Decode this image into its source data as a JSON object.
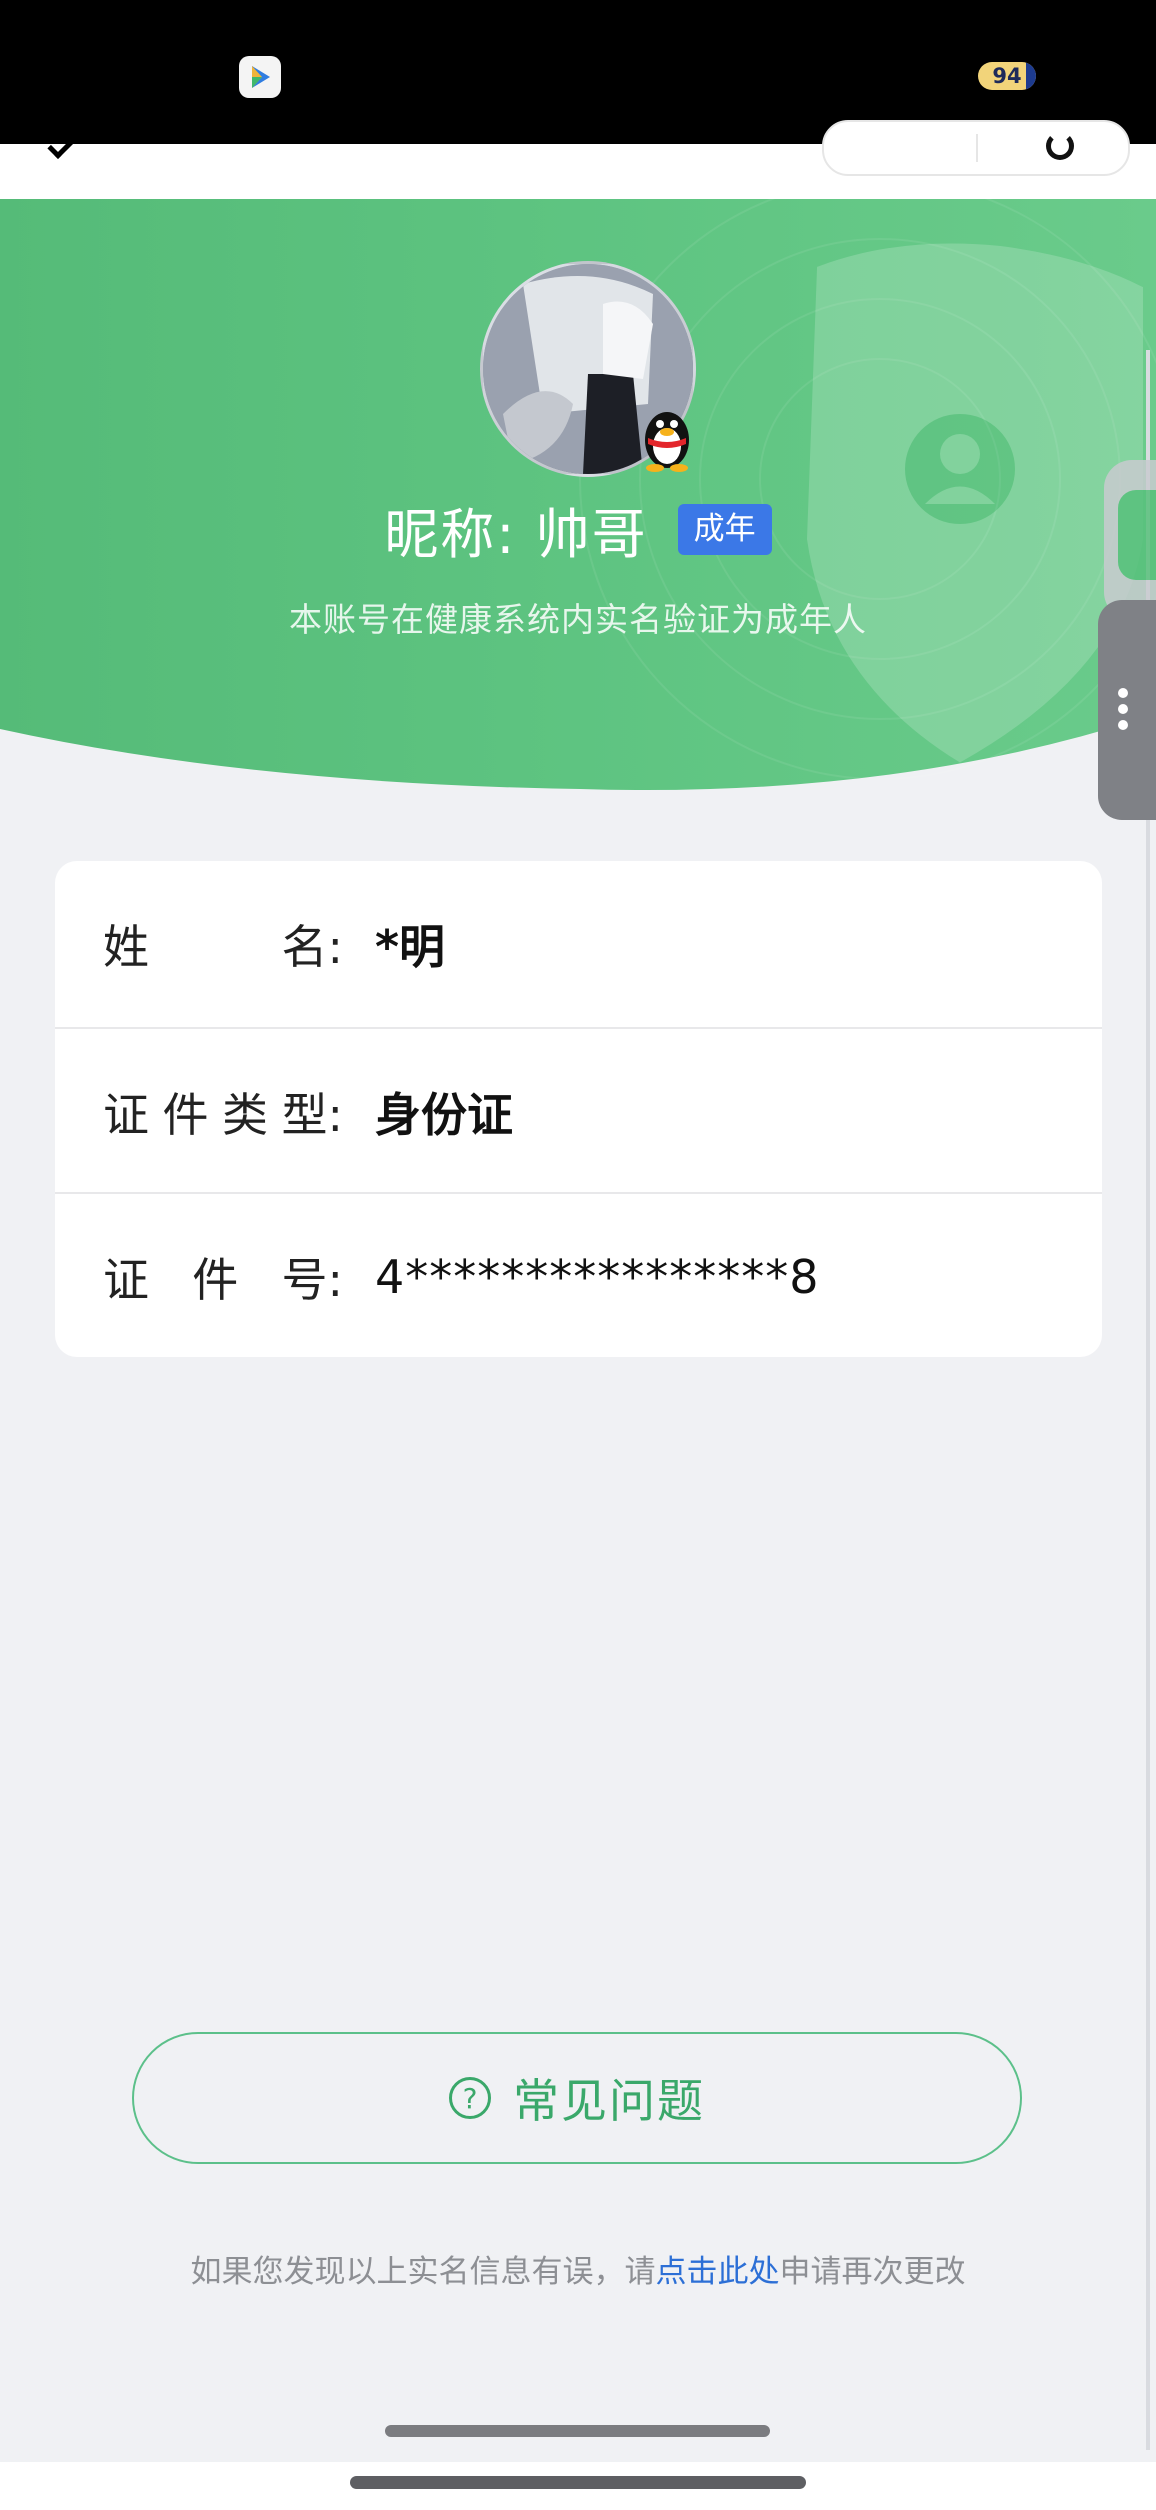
{
  "profile": {
    "nickname": "昵称:  帅哥",
    "adult_tag": "成年",
    "subtitle": "本账号在健康系统内实名验证为成年人"
  },
  "status_bar": {
    "battery_level": "94"
  },
  "info": {
    "name_label_chars": [
      "姓",
      "名:"
    ],
    "name_value": "*明",
    "id_type_label_chars": [
      "证",
      "件",
      "类",
      "型:"
    ],
    "id_type_value": "身份证",
    "id_number_label_chars": [
      "证",
      "件",
      "号:"
    ],
    "id_number_value": "4****************8"
  },
  "faq": {
    "icon": "question-circle-icon",
    "label": "常见问题"
  },
  "footer": {
    "prefix": "如果您发现以上实名信息有误，请",
    "link": "点击此处",
    "suffix": "申请再次更改"
  },
  "colors": {
    "header_green": "#5cc07e",
    "tag_blue": "#3b78e7",
    "faq_green": "#3aa86a",
    "link_blue": "#2c6fd6"
  }
}
